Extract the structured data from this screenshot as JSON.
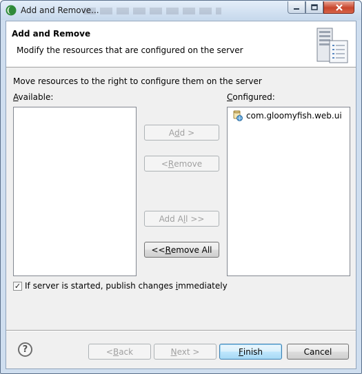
{
  "window": {
    "title": "Add and Remove..."
  },
  "header": {
    "title": "Add and Remove",
    "description": "Modify the resources that are configured on the server"
  },
  "instruction": "Move resources to the right to configure them on the server",
  "available": {
    "label_mnemonic": "A",
    "label_rest": "vailable:",
    "items": []
  },
  "configured": {
    "label_mnemonic": "C",
    "label_rest": "onfigured:",
    "items": [
      {
        "label": "com.gloomyfish.web.ui",
        "icon": "web-project-icon"
      }
    ]
  },
  "buttons": {
    "add": {
      "pre": "A",
      "mn": "d",
      "post": "d >",
      "enabled": false
    },
    "remove": {
      "pre": "< ",
      "mn": "R",
      "post": "emove",
      "enabled": false
    },
    "add_all": {
      "pre": "Add A",
      "mn": "l",
      "post": "l >>",
      "enabled": false
    },
    "remove_all": {
      "pre": "<< ",
      "mn": "R",
      "post": "emove All",
      "enabled": true
    }
  },
  "publish_checkbox": {
    "checked": true,
    "pre": "If server is started, publish changes ",
    "mn": "i",
    "post": "mmediately"
  },
  "footer": {
    "help_symbol": "?",
    "back": {
      "pre": "< ",
      "mn": "B",
      "post": "ack",
      "enabled": false
    },
    "next": {
      "pre": "",
      "mn": "N",
      "post": "ext >",
      "enabled": false
    },
    "finish": {
      "pre": "",
      "mn": "F",
      "post": "inish",
      "enabled": true
    },
    "cancel": {
      "label": "Cancel",
      "enabled": true
    }
  },
  "colors": {
    "window_frame": "#cfdeef",
    "dialog_bg": "#f0f0f0",
    "close_button": "#c8452c",
    "default_button_border": "#3c7fb1"
  }
}
